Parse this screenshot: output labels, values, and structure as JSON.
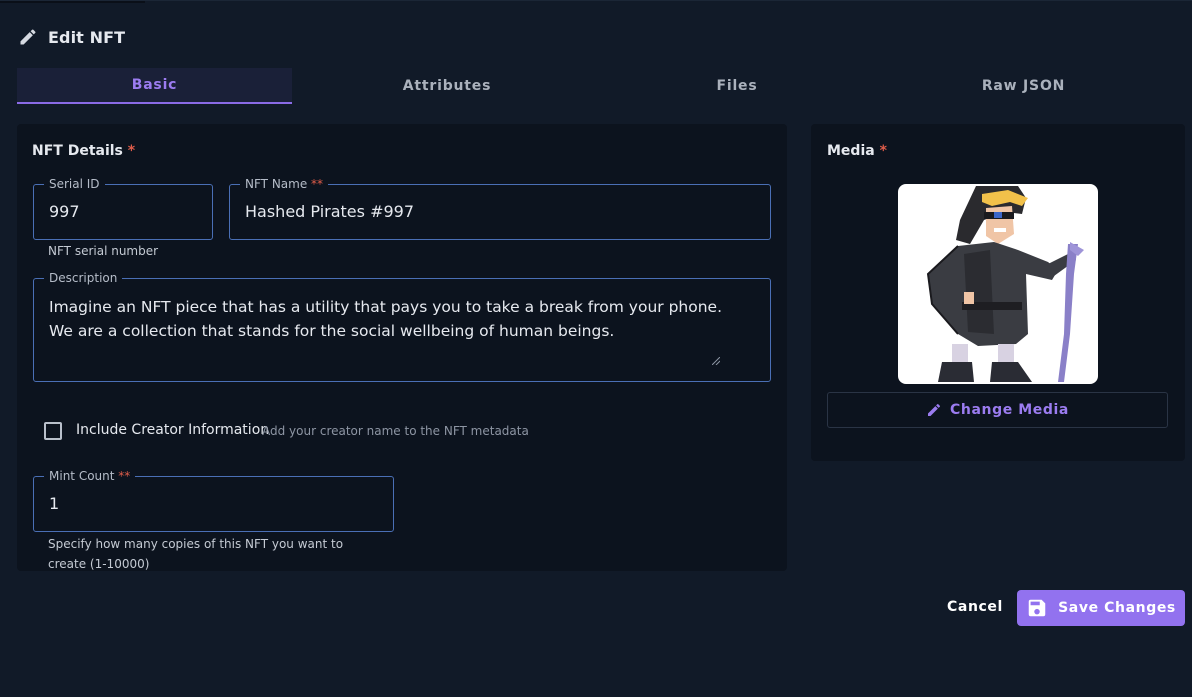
{
  "dialog": {
    "title": "Edit NFT",
    "title_icon": "pencil-icon"
  },
  "tabs": [
    {
      "label": "Basic",
      "active": true
    },
    {
      "label": "Attributes",
      "active": false
    },
    {
      "label": "Files",
      "active": false
    },
    {
      "label": "Raw JSON",
      "active": false
    }
  ],
  "details": {
    "title": "NFT Details",
    "required_mark": "*",
    "serial": {
      "label": "Serial ID",
      "value": "997",
      "helper": "NFT serial number"
    },
    "name": {
      "label": "NFT Name",
      "required_mark": "**",
      "value": "Hashed Pirates #997"
    },
    "description": {
      "label": "Description",
      "lines": [
        "Imagine an NFT piece that has a utility that pays you to take a break from your phone.",
        "We are a collection that stands for the social wellbeing of human beings."
      ]
    },
    "creator": {
      "label": "Include Creator Information",
      "hint": "Add your creator name to the NFT metadata",
      "checked": false
    },
    "mint_count": {
      "label": "Mint Count",
      "required_mark": "**",
      "value": "1",
      "helper_line1": "Specify how many copies of this NFT you want to",
      "helper_line2": "create (1-10000)"
    }
  },
  "media": {
    "title": "Media",
    "required_mark": "*",
    "change_label": "Change Media",
    "change_icon": "pencil-icon"
  },
  "actions": {
    "cancel_label": "Cancel",
    "save_label": "Save Changes",
    "save_icon": "floppy-disk-icon"
  },
  "colors": {
    "accent": "#9272ef",
    "required": "#e05d4a",
    "field_border": "#4a6fb5"
  }
}
